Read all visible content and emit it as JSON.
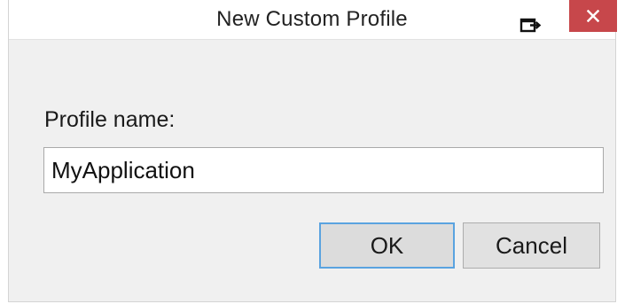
{
  "window": {
    "title": "New Custom Profile",
    "pin_icon": "window-pin-icon",
    "close_icon": "close-icon",
    "close_color": "#c7474b"
  },
  "form": {
    "label": "Profile name:",
    "input_value": "MyApplication"
  },
  "buttons": {
    "ok_label": "OK",
    "cancel_label": "Cancel",
    "default_border_color": "#5aa3e0"
  }
}
